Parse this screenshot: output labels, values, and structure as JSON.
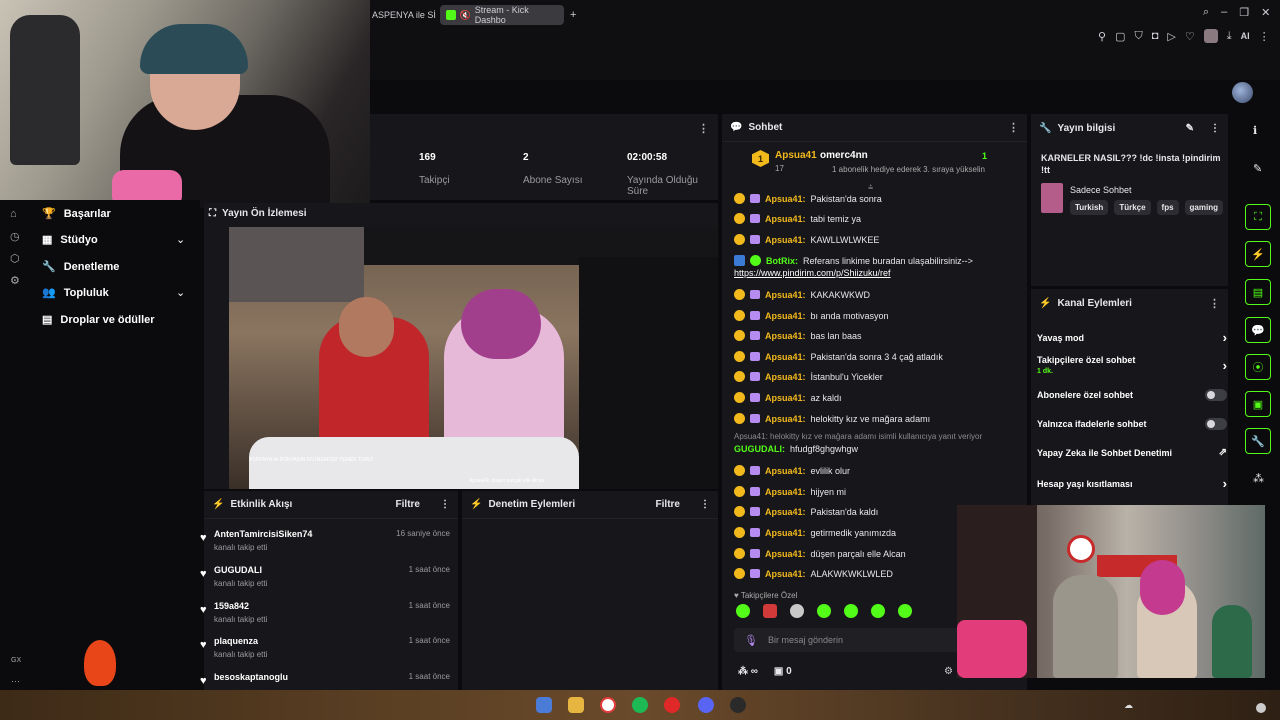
{
  "browser": {
    "tabs": [
      {
        "label": "ASPENYA ile Sİ"
      },
      {
        "label": "Stream - Kick Dashbo"
      }
    ],
    "new_tab": "+",
    "ai_label": "AI"
  },
  "stats_panel": {
    "stats": [
      {
        "value": "169",
        "label": "Takipçi"
      },
      {
        "value": "2",
        "label": "Abone Sayısı"
      },
      {
        "value": "02:00:58",
        "label": "Yayında Olduğu Süre"
      }
    ]
  },
  "sidebar": {
    "items": [
      {
        "label": "Başarılar"
      },
      {
        "label": "Stüdyo"
      },
      {
        "label": "Denetleme"
      },
      {
        "label": "Topluluk"
      },
      {
        "label": "Droplar ve ödüller"
      }
    ],
    "gx_label": "GX"
  },
  "preview": {
    "title": "Yayın Ön İzlemesi",
    "overlay_text": "ASPENYA ile DÜNYANIN EN İNSAFSIZ YEMEK TURU!",
    "bottom_chat_text": "Apsua41: düşen parçalı elle Alcan"
  },
  "activity_feed": {
    "title": "Etkinlik Akışı",
    "filter": "Filtre",
    "items": [
      {
        "name": "AntenTamircisiSiken74",
        "sub": "kanalı takip etti",
        "time": "16 saniye önce"
      },
      {
        "name": "GUGUDALI",
        "sub": "kanalı takip etti",
        "time": "1 saat önce"
      },
      {
        "name": "159a842",
        "sub": "kanalı takip etti",
        "time": "1 saat önce"
      },
      {
        "name": "plaquenza",
        "sub": "kanalı takip etti",
        "time": "1 saat önce"
      },
      {
        "name": "besoskaptanoglu",
        "sub": "",
        "time": "1 saat önce"
      }
    ]
  },
  "moderation": {
    "title": "Denetim Eylemleri",
    "filter": "Filtre"
  },
  "chat": {
    "title": "Sohbet",
    "pinned": {
      "user": "Apsua41",
      "count": "17",
      "target": "omerc4nn",
      "gift_count": "1",
      "gift_text": "1 abonelik hediye ederek 3. sıraya yükselin"
    },
    "messages": [
      {
        "user": "Apsua41",
        "text": "Pakistan'da sonra",
        "type": "gold"
      },
      {
        "user": "Apsua41",
        "text": "tabi temiz ya",
        "type": "gold"
      },
      {
        "user": "Apsua41",
        "text": "KAWLLWLWKEE",
        "type": "gold"
      },
      {
        "user": "BotRix",
        "text": "Referans linkime buradan ulaşabilirsiniz-->",
        "type": "bot",
        "link": "https://www.pindirim.com/p/Shiizuku/ref"
      },
      {
        "user": "Apsua41",
        "text": "KAKAKWKWD",
        "type": "gold"
      },
      {
        "user": "Apsua41",
        "text": "bı anda motivasyon",
        "type": "gold"
      },
      {
        "user": "Apsua41",
        "text": "bas lan baas",
        "type": "gold"
      },
      {
        "user": "Apsua41",
        "text": "Pakistan'da sonra 3 4 çağ atladık",
        "type": "gold"
      },
      {
        "user": "Apsua41",
        "text": "İstanbul'u Yicekler",
        "type": "gold"
      },
      {
        "user": "Apsua41",
        "text": "az kaldı",
        "type": "gold"
      },
      {
        "user": "Apsua41",
        "text": "helokitty kız ve mağara adamı",
        "type": "gold"
      }
    ],
    "reply_note": "Apsua41: helokitty kız ve mağara adamı isimli kullanıcıya yanıt veriyor",
    "reply": {
      "user": "GUGUDALI",
      "text": "hfudgf8ghgwhgw"
    },
    "messages2": [
      {
        "user": "Apsua41",
        "text": "evlilik olur"
      },
      {
        "user": "Apsua41",
        "text": "hijyen mi"
      },
      {
        "user": "Apsua41",
        "text": "Pakistan'da kaldı"
      },
      {
        "user": "Apsua41",
        "text": "getirmedik yanımızda"
      },
      {
        "user": "Apsua41",
        "text": "düşen parçalı elle Alcan"
      },
      {
        "user": "Apsua41",
        "text": "ALAKWKWKLWLED"
      }
    ],
    "followers_only": "Takipçilere Özel",
    "input_placeholder": "Bir mesaj gönderin",
    "footer_count": "0",
    "footer_infinity": "∞"
  },
  "stream_info": {
    "title": "Yayın bilgisi",
    "stream_title": "KARNELER NASIL??? !dc !insta !pindirim !tt",
    "category": "Sadece Sohbet",
    "tags": [
      "Turkish",
      "Türkçe",
      "fps",
      "gaming"
    ]
  },
  "channel_actions": {
    "title": "Kanal Eylemleri",
    "items": [
      {
        "label": "Yavaş mod",
        "control": "chevron"
      },
      {
        "label": "Takipçilere özel sohbet",
        "sub": "1 dk.",
        "control": "chevron"
      },
      {
        "label": "Abonelere özel sohbet",
        "control": "toggle"
      },
      {
        "label": "Yalnızca ifadelerle sohbet",
        "control": "toggle"
      },
      {
        "label": "Yapay Zeka ile Sohbet Denetimi",
        "control": "external"
      },
      {
        "label": "Hesap yaşı kısıtlaması",
        "control": "chevron"
      }
    ]
  },
  "colors": {
    "kick_green": "#53fc18",
    "gold": "#f2b91c",
    "panel": "#17171b"
  }
}
